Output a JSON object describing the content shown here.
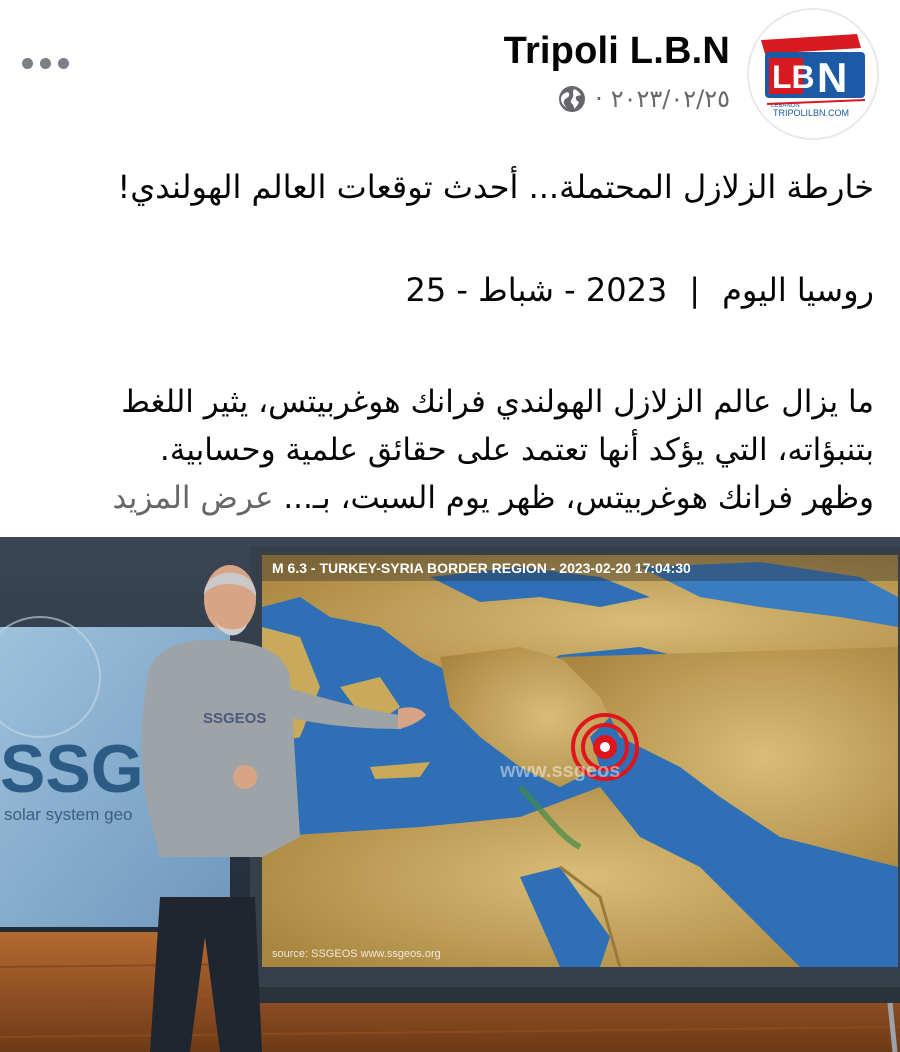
{
  "post": {
    "page_name": "Tripoli L.B.N",
    "date": "٢٠٢٣/٠٢/٢٥",
    "separator": "·",
    "privacy_icon": "globe-icon",
    "more_icon": "more-options-icon",
    "avatar": {
      "logo_letters": "LBN",
      "logo_caption": "TRIPOLILBN.COM",
      "logo_small": "LEBANON"
    },
    "title": "خارطة الزلازل المحتملة... أحدث توقعات العالم الهولندي!",
    "source_line": {
      "source": "روسيا اليوم",
      "divider": "|",
      "date": "2023 - شباط - 25"
    },
    "body_lines": [
      "ما يزال عالم الزلازل الهولندي فرانك هوغربيتس، يثير اللغط",
      "بتنبؤاته، التي يؤكد أنها تعتمد على حقائق علمية وحسابية.",
      "وظهر فرانك هوغربيتس، ظهر يوم السبت، بـ..."
    ],
    "see_more": "عرض المزيد"
  },
  "media": {
    "map_banner": "M 6.3 - TURKEY-SYRIA BORDER REGION - 2023-02-20 17:04:30",
    "map_source": "source: SSGEOS   www.ssgeos.org",
    "map_watermark": "www.ssgeos",
    "sweater_logo": "SSGEOS",
    "screen_brand": "SSGE",
    "screen_tagline": "solar system geo",
    "colors": {
      "sea": "#2f6fb5",
      "land": "#c9a95a",
      "quake_marker": "#e0141b"
    }
  }
}
